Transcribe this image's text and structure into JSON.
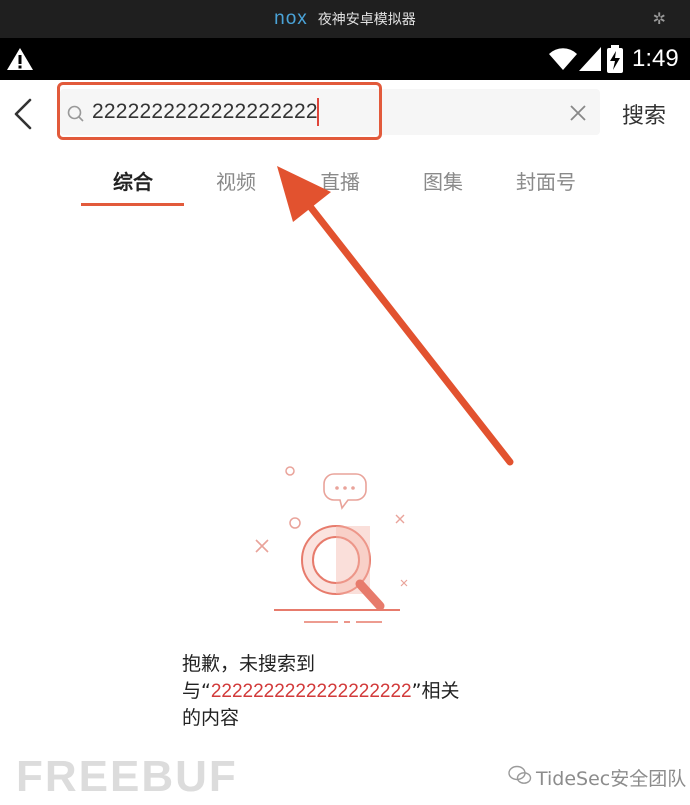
{
  "emulator": {
    "logo": "nox",
    "title": "夜神安卓模拟器"
  },
  "status_bar": {
    "time": "1:49"
  },
  "search": {
    "value": "2222222222222222222",
    "button_label": "搜索"
  },
  "tabs": [
    {
      "label": "综合",
      "active": true
    },
    {
      "label": "视频",
      "active": false
    },
    {
      "label": "直播",
      "active": false
    },
    {
      "label": "图集",
      "active": false
    },
    {
      "label": "封面号",
      "active": false
    }
  ],
  "empty_state": {
    "line1": "抱歉，未搜索到",
    "prefix": "与“",
    "keyword": "2222222222222222222",
    "suffix": "”相关",
    "line3": "的内容"
  },
  "watermarks": {
    "left": "FREEBUF",
    "right": "TideSec安全团队"
  },
  "colors": {
    "accent": "#e25a3b",
    "keyword": "#d23a3a"
  }
}
